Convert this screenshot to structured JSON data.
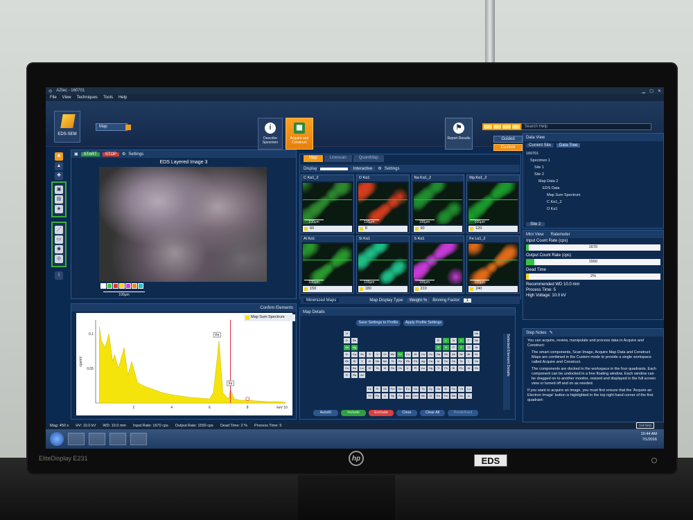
{
  "window": {
    "title": "AZtec - 160701"
  },
  "menu": [
    "File",
    "View",
    "Techniques",
    "Tools",
    "Help"
  ],
  "ribbon": {
    "app_label": "EDS-SEM",
    "mode_label": "Map",
    "describe_label": "Describe Specimen",
    "acquire_label": "Acquire and Construct",
    "report_label": "Report Results",
    "guided_label": "Guided",
    "custom_label": "Custom",
    "search_placeholder": "Search Help"
  },
  "image_panel": {
    "start_label": "START",
    "stop_label": "STOP",
    "settings_label": "Settings",
    "title": "EDS Layered Image 3",
    "scalebar": "100μm"
  },
  "map_panel": {
    "tabs": [
      "Map",
      "Linescan",
      "QuantMap"
    ],
    "display_label": "Display",
    "interactive_label": "Interactive",
    "settings_label": "Settings",
    "cells": [
      {
        "label": "C Kα1_2",
        "value": "60",
        "color": "#2e8a2f"
      },
      {
        "label": "O Kα1",
        "value": "0",
        "color": "#d63c1e"
      },
      {
        "label": "Na Kα1_2",
        "value": "90",
        "color": "#1f8f2e"
      },
      {
        "label": "Mg Kα1_2",
        "value": "120",
        "color": "#1c9b2c"
      },
      {
        "label": "Al Kα1",
        "value": "150",
        "color": "#2a9a2e"
      },
      {
        "label": "Si Kα1",
        "value": "180",
        "color": "#1dc08a"
      },
      {
        "label": "S Kα1",
        "value": "210",
        "color": "#c93ad8"
      },
      {
        "label": "Fe Lα1_2",
        "value": "240",
        "color": "#e46b19"
      }
    ],
    "scalebar": "100μm",
    "minimized_maps": "Minimized Maps",
    "map_display_type_label": "Map Display Type:",
    "map_display_type": "Weight %",
    "binning_label": "Binning Factor:",
    "binning": "1"
  },
  "spectrum_panel": {
    "confirm_label": "Confirm Elements",
    "legend": "Map Sum Spectrum",
    "ylabel": "cps/eV",
    "xlabel": "keV",
    "peak_labels": [
      "Fe",
      "Fe"
    ]
  },
  "chart_data": {
    "type": "line",
    "title": "",
    "xlabel": "keV",
    "ylabel": "cps/eV",
    "xlim": [
      0,
      10
    ],
    "ylim": [
      0,
      0.12
    ],
    "x_ticks": [
      "2",
      "4",
      "6",
      "8",
      "10"
    ],
    "y_ticks": [
      "0.05",
      "0.1"
    ],
    "series": [
      {
        "name": "Map Sum Spectrum",
        "x": [
          0.2,
          0.3,
          0.5,
          0.7,
          0.9,
          1.0,
          1.2,
          1.5,
          1.7,
          1.9,
          2.2,
          2.5,
          3.0,
          3.5,
          4.0,
          4.5,
          5.0,
          5.5,
          6.0,
          6.2,
          6.4,
          6.5,
          6.7,
          7.0,
          7.1,
          7.3,
          7.6,
          8.0,
          8.5,
          9.0,
          9.5,
          10.0
        ],
        "y": [
          0.11,
          0.09,
          0.08,
          0.1,
          0.06,
          0.07,
          0.05,
          0.08,
          0.04,
          0.06,
          0.03,
          0.025,
          0.02,
          0.015,
          0.012,
          0.01,
          0.008,
          0.007,
          0.006,
          0.015,
          0.065,
          0.09,
          0.015,
          0.006,
          0.02,
          0.006,
          0.004,
          0.004,
          0.003,
          0.002,
          0.002,
          0.001
        ]
      }
    ],
    "colors": {
      "series": "#f5e40c",
      "marker": "#e0223b"
    }
  },
  "map_details": {
    "title": "Map Details",
    "save_profile": "Save Settings to Profile",
    "apply_profile": "Apply Profile Settings",
    "side_label": "Selected Element Details",
    "buttons": [
      "AutoID",
      "Include",
      "Exclude",
      "Clear",
      "Clear All",
      "Predefined"
    ]
  },
  "data_view": {
    "title": "Data View",
    "tabs": [
      "Current Site",
      "Data Tree"
    ],
    "tree": [
      "160701",
      "Specimen 1",
      "Site 1",
      "Site 2",
      "Map Data 2",
      "EDS Data",
      "Map Sum Spectrum",
      "C Kα1_2",
      "O Kα1"
    ],
    "site_selector": "Site 2"
  },
  "mini_view": {
    "tabs": [
      "Mini View",
      "Ratemeter"
    ],
    "input_label": "Input Count Rate (cps)",
    "input_value": "1670",
    "input_fill": 0.02,
    "output_label": "Output Count Rate (cps)",
    "output_value": "1550",
    "output_fill": 0.06,
    "dead_label": "Dead Time",
    "dead_value": "2%",
    "dead_fill": 0.02,
    "recommended": "Recommended WD 10.0 mm",
    "process_time": "Process Time: 5",
    "high_voltage": "High Voltage: 10.0 kV"
  },
  "step_notes": {
    "title": "Step Notes",
    "intro": "You can acquire, review, manipulate and process data in Acquire and Construct:",
    "bullets": [
      "The smart components, Scan Image, Acquire Map Data and Construct Maps are combined in the Custom mode to provide a single workspace called Acquire and Construct.",
      "The components are docked in the workspace in the four quadrants. Each component can be undocked in a free floating window. Each window can be dragged on to another monitor, resized and displayed in the full screen view or turned off and on as needed."
    ],
    "footer": "If you want to acquire an image, you must first ensure that the 'Acquire an Electron Image' button is highlighted in the top right hand corner of the first quadrant:"
  },
  "status": {
    "mag": "Mag: 450 x",
    "hv": "HV: 10.0 kV",
    "wd": "WD: 10.0 mm",
    "input_rate": "Input Rate: 1670 cps",
    "output_rate": "Output Rate: 1550 cps",
    "dead_time": "Dead Time: 2 %",
    "process_time": "Process Time: 5",
    "brand": "OXFORD"
  },
  "taskbar": {
    "time": "10:44 AM",
    "date": "7/1/2016"
  },
  "monitor": {
    "model": "EliteDisplay E231",
    "sticker": "EDS",
    "logo": "hp"
  }
}
